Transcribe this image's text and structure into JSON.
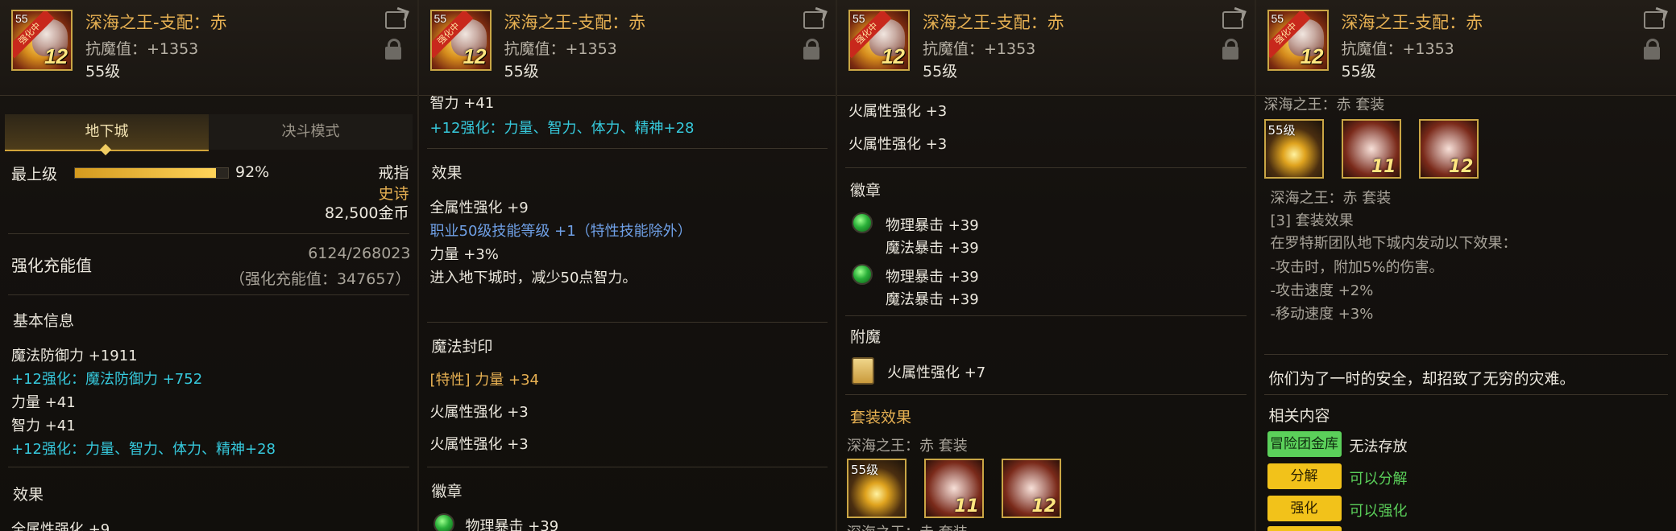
{
  "item": {
    "name": "深海之王-支配：赤",
    "resist": "抗魔值：+1353",
    "level": "55级",
    "icon_level": "55",
    "icon_ribbon": "强化中",
    "icon_number": "12"
  },
  "p1": {
    "tab_dungeon": "地下城",
    "tab_duel": "决斗模式",
    "grade_label": "最上级",
    "grade_percent": "92%",
    "grade_fraction": 0.92,
    "slot_type": "戒指",
    "rarity": "史诗",
    "price": "82,500金币",
    "charge_label": "强化充能值",
    "charge_value": "6124/268023",
    "charge_sub": "（强化充能值：347657）",
    "basic_info": "基本信息",
    "lines": [
      "魔法防御力 +1911",
      "+12强化：魔法防御力 +752",
      "力量 +41",
      "智力 +41",
      "+12强化：力量、智力、体力、精神+28"
    ],
    "effect": "效果",
    "effect_partial": "全属性强化 +9"
  },
  "p2": {
    "top_partial": "智力 +41",
    "top_cyan": "+12强化：力量、智力、体力、精神+28",
    "effect": "效果",
    "e1": "全属性强化 +9",
    "e2": "职业50级技能等级 +1（特性技能除外）",
    "e3": "力量 +3%",
    "e4": "进入地下城时，减少50点智力。",
    "seal": "魔法封印",
    "seal_tag": "[特性]",
    "seal_val": "力量 +34",
    "fire1": "火属性强化 +3",
    "fire2": "火属性强化 +3",
    "emblem": "徽章",
    "emblem1": "物理暴击 +39"
  },
  "p3": {
    "fire1": "火属性强化 +3",
    "fire2": "火属性强化 +3",
    "emblem": "徽章",
    "g1a": "物理暴击 +39",
    "g1b": "魔法暴击 +39",
    "g2a": "物理暴击 +39",
    "g2b": "魔法暴击 +39",
    "enchant": "附魔",
    "enchant_val": "火属性强化 +7",
    "set_effect": "套装效果",
    "set_name": "深海之王：赤 套装",
    "slot1_level": "55级",
    "slot2_num": "11",
    "slot3_num": "12",
    "bottom_partial": "深海之王：赤 套装"
  },
  "p4": {
    "top_partial": "深海之王：赤 套装",
    "slot1_level": "55级",
    "slot2_num": "11",
    "slot3_num": "12",
    "set_name": "深海之王：赤 套装",
    "set_count": "[3] 套装效果",
    "set_desc": "在罗特斯团队地下城内发动以下效果：",
    "set_l1": "-攻击时，附加5%的伤害。",
    "set_l2": "-攻击速度 +2%",
    "set_l3": "-移动速度 +3%",
    "flavor": "你们为了一时的安全，却招致了无穷的灾难。",
    "related": "相关内容",
    "badge1": "冒险团金库",
    "badge1_text": "无法存放",
    "badge2": "分解",
    "badge2_text": "可以分解",
    "badge3": "强化",
    "badge3_text": "可以强化"
  },
  "colors": {
    "title": "#e6b052",
    "cyan": "#36c9dc",
    "blue": "#6fa0e6",
    "green_badge": "#5bd05a",
    "gold_badge": "#f2c21a",
    "green_text": "#5bd05a"
  }
}
